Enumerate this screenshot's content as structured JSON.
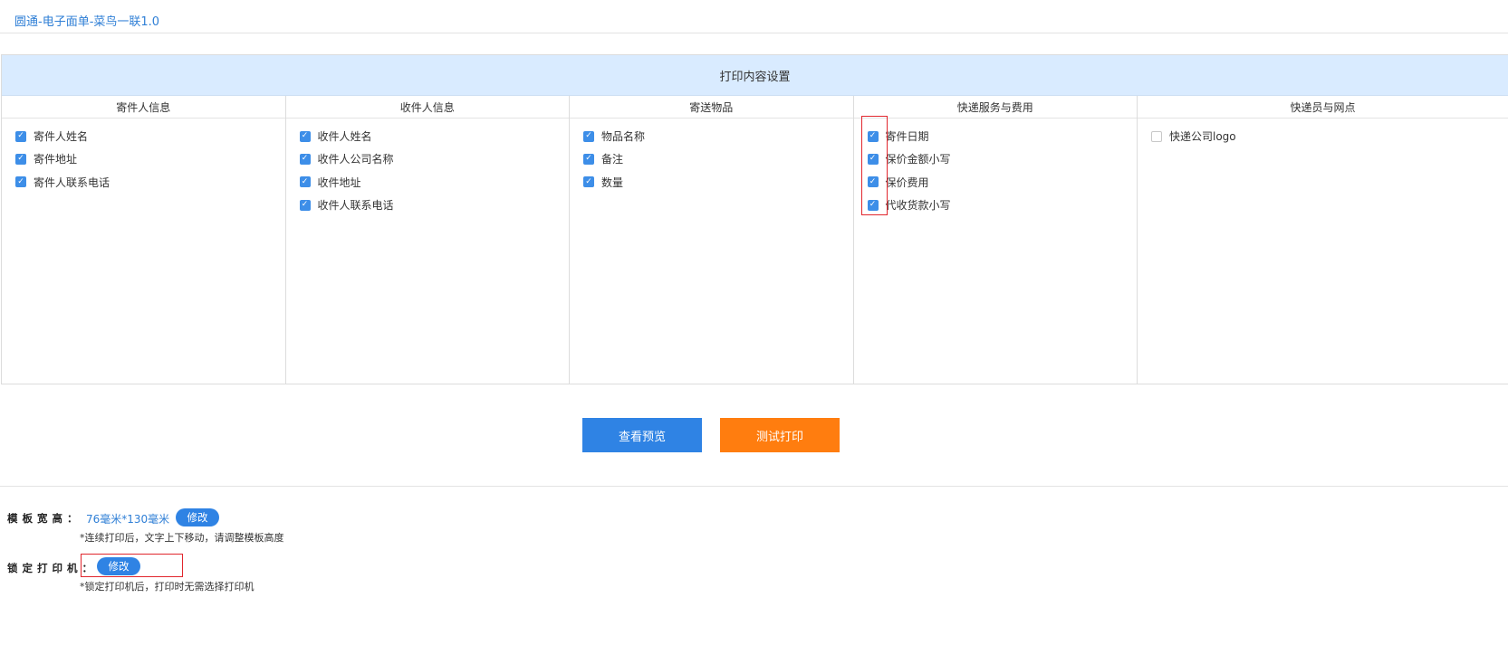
{
  "template": {
    "title": "圆通-电子面单-菜鸟一联1.0"
  },
  "settings": {
    "heading": "打印内容设置",
    "columns": [
      {
        "title": "寄件人信息",
        "items": [
          {
            "label": "寄件人姓名",
            "checked": true
          },
          {
            "label": "寄件地址",
            "checked": true
          },
          {
            "label": "寄件人联系电话",
            "checked": true
          }
        ]
      },
      {
        "title": "收件人信息",
        "items": [
          {
            "label": "收件人姓名",
            "checked": true
          },
          {
            "label": "收件人公司名称",
            "checked": true
          },
          {
            "label": "收件地址",
            "checked": true
          },
          {
            "label": "收件人联系电话",
            "checked": true
          }
        ]
      },
      {
        "title": "寄送物品",
        "items": [
          {
            "label": "物品名称",
            "checked": true
          },
          {
            "label": "备注",
            "checked": true
          },
          {
            "label": "数量",
            "checked": true
          }
        ]
      },
      {
        "title": "快递服务与费用",
        "items": [
          {
            "label": "寄件日期",
            "checked": true
          },
          {
            "label": "保价金额小写",
            "checked": true
          },
          {
            "label": "保价费用",
            "checked": true
          },
          {
            "label": "代收货款小写",
            "checked": true
          }
        ]
      },
      {
        "title": "快递员与网点",
        "items": [
          {
            "label": "快递公司logo",
            "checked": false
          }
        ]
      }
    ]
  },
  "actions": {
    "preview_label": "查看预览",
    "test_print_label": "测试打印"
  },
  "size": {
    "label": "模板宽高：",
    "value": "76毫米*130毫米",
    "edit_label": "修改",
    "note": "*连续打印后，文字上下移动，请调整模板高度"
  },
  "printer": {
    "label": "锁定打印机：",
    "edit_label": "修改",
    "note": "*锁定打印机后，打印时无需选择打印机"
  },
  "colors": {
    "accent": "#2f83e4",
    "print_button": "#ff7d0f",
    "header_bg": "#d9ebff",
    "highlight": "#e1262d"
  }
}
